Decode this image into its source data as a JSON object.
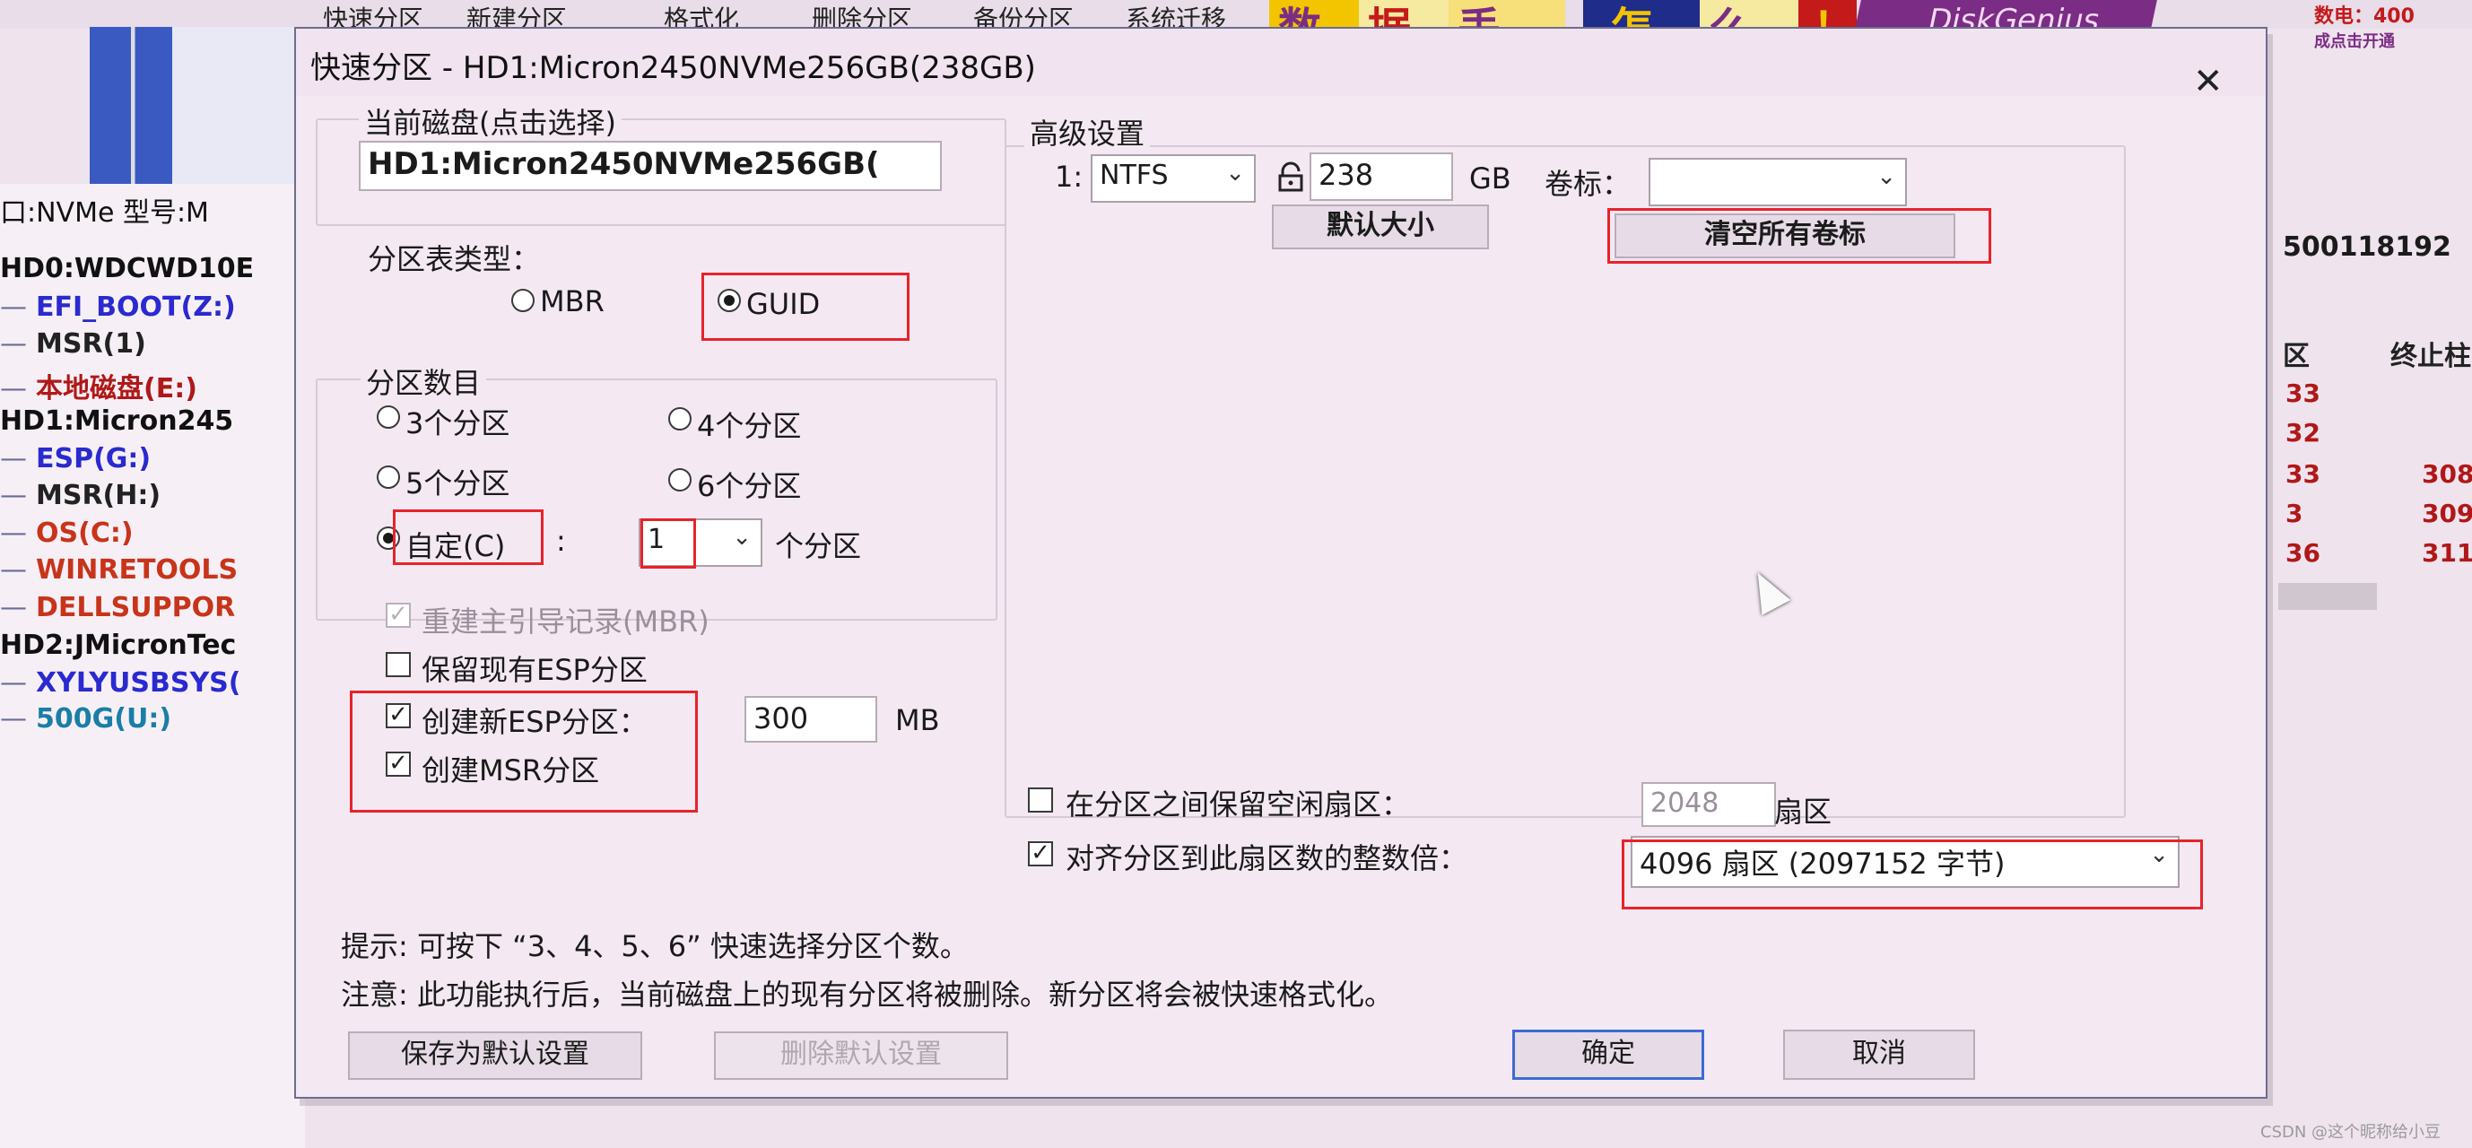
{
  "background": {
    "toolbar": [
      "快速分区",
      "新建分区",
      "格式化",
      "删除分区",
      "备份分区",
      "系统迁移"
    ],
    "banner_chars": [
      "数",
      "据",
      "丢",
      "怎",
      "么",
      "！"
    ],
    "brand": "DiskGenius",
    "phone_line1": "数电：400",
    "phone_line2": "成点击开通",
    "left_header": "口:NVMe  型号:M",
    "tree": [
      {
        "text": "HD0:WDCWD10E",
        "color": "#111111",
        "arrow": false
      },
      {
        "text": "EFI_BOOT(Z:)",
        "color": "#2a2ad0",
        "arrow": true
      },
      {
        "text": "MSR(1)",
        "color": "#222222",
        "arrow": true
      },
      {
        "text": "本地磁盘(E:)",
        "color": "#b01818",
        "arrow": true
      },
      {
        "text": "HD1:Micron245",
        "color": "#111111",
        "arrow": false
      },
      {
        "text": "ESP(G:)",
        "color": "#2a2ad0",
        "arrow": true
      },
      {
        "text": "MSR(H:)",
        "color": "#222222",
        "arrow": true
      },
      {
        "text": "OS(C:)",
        "color": "#c8341a",
        "arrow": true
      },
      {
        "text": "WINRETOOLS",
        "color": "#c8341a",
        "arrow": true
      },
      {
        "text": "DELLSUPPOR",
        "color": "#c8341a",
        "arrow": true
      },
      {
        "text": "HD2:JMicronTec",
        "color": "#111111",
        "arrow": false
      },
      {
        "text": "XYLYUSBSYS(",
        "color": "#2a2ad0",
        "arrow": true
      },
      {
        "text": "500G(U:)",
        "color": "#1a7ea6",
        "arrow": true
      }
    ],
    "right_top": "500118192",
    "right_header_1": "区",
    "right_header_2": "终止柱",
    "right_rows": [
      {
        "a": "33",
        "b": ""
      },
      {
        "a": "32",
        "b": ""
      },
      {
        "a": "33",
        "b": "308"
      },
      {
        "a": "3",
        "b": "309"
      },
      {
        "a": "36",
        "b": "311"
      }
    ]
  },
  "dialog": {
    "title": "快速分区 - HD1:Micron2450NVMe256GB(238GB)",
    "current_disk_label": "当前磁盘(点击选择)",
    "current_disk_value": "HD1:Micron2450NVMe256GB(",
    "partition_table_label": "分区表类型：",
    "mbr_label": "MBR",
    "guid_label": "GUID",
    "partition_count_label": "分区数目",
    "opt3": "3个分区",
    "opt4": "4个分区",
    "opt5": "5个分区",
    "opt6": "6个分区",
    "custom_label": "自定(C)",
    "custom_colon": ":",
    "custom_count": "1",
    "custom_unit": "个分区",
    "rebuild_mbr": "重建主引导记录(MBR)",
    "keep_esp": "保留现有ESP分区",
    "create_esp": "创建新ESP分区：",
    "esp_size": "300",
    "esp_unit": "MB",
    "create_msr": "创建MSR分区",
    "advanced_label": "高级设置",
    "row_index": "1:",
    "fs_type": "NTFS",
    "size_value": "238",
    "size_unit": "GB",
    "volume_label": "卷标：",
    "volume_value": "",
    "default_size_btn": "默认大小",
    "clear_labels_btn": "清空所有卷标",
    "reserve_gap_label": "在分区之间保留空闲扇区：",
    "reserve_gap_value": "2048",
    "reserve_gap_unit": "扇区",
    "align_label": "对齐分区到此扇区数的整数倍：",
    "align_value": "4096 扇区 (2097152 字节)",
    "hint": "提示: 可按下 “3、4、5、6” 快速选择分区个数。",
    "note": "注意: 此功能执行后，当前磁盘上的现有分区将被删除。新分区将会被快速格式化。",
    "save_default_btn": "保存为默认设置",
    "delete_default_btn": "删除默认设置",
    "ok_btn": "确定",
    "cancel_btn": "取消",
    "close_glyph": "✕",
    "checked_glyph": "✓"
  },
  "watermark": "CSDN @这个昵称给小豆",
  "colors": {
    "highlight_box": "#e8232a",
    "primary_border": "#3a6bd6"
  }
}
